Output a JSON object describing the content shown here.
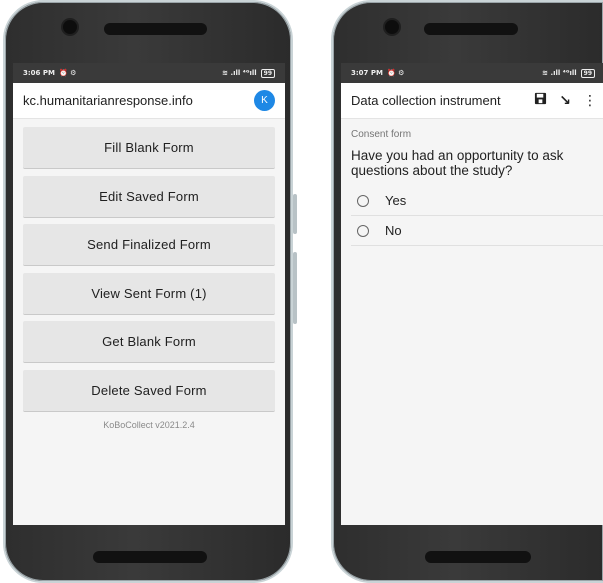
{
  "left_phone": {
    "status": {
      "time": "3:06 PM",
      "icons": "⏰ ⚙",
      "signal": "≋ .ıll ⁴ᴳıll",
      "battery": "99"
    },
    "appbar": {
      "title": "kc.humanitarianresponse.info",
      "avatar_letter": "K"
    },
    "menu": [
      {
        "label": "Fill Blank Form"
      },
      {
        "label": "Edit Saved Form"
      },
      {
        "label": "Send Finalized Form"
      },
      {
        "label": "View Sent Form (1)"
      },
      {
        "label": "Get Blank Form"
      },
      {
        "label": "Delete Saved Form"
      }
    ],
    "version": "KoBoCollect v2021.2.4"
  },
  "right_phone": {
    "status": {
      "time": "3:07 PM",
      "icons": "⏰ ⚙",
      "signal": "≋ .ıll ⁴ᴳıll",
      "battery": "99"
    },
    "appbar": {
      "title": "Data collection instrument",
      "save_icon": "💾",
      "go_icon": "↘",
      "more_icon": "⋮"
    },
    "form": {
      "section": "Consent form",
      "question": "Have you had an opportunity to ask questions about the study?",
      "options": [
        {
          "label": "Yes"
        },
        {
          "label": "No"
        }
      ]
    }
  },
  "colors": {
    "accent": "#1e88e5",
    "statusbar": "#3a3a3a",
    "phone_body": "#333333"
  }
}
